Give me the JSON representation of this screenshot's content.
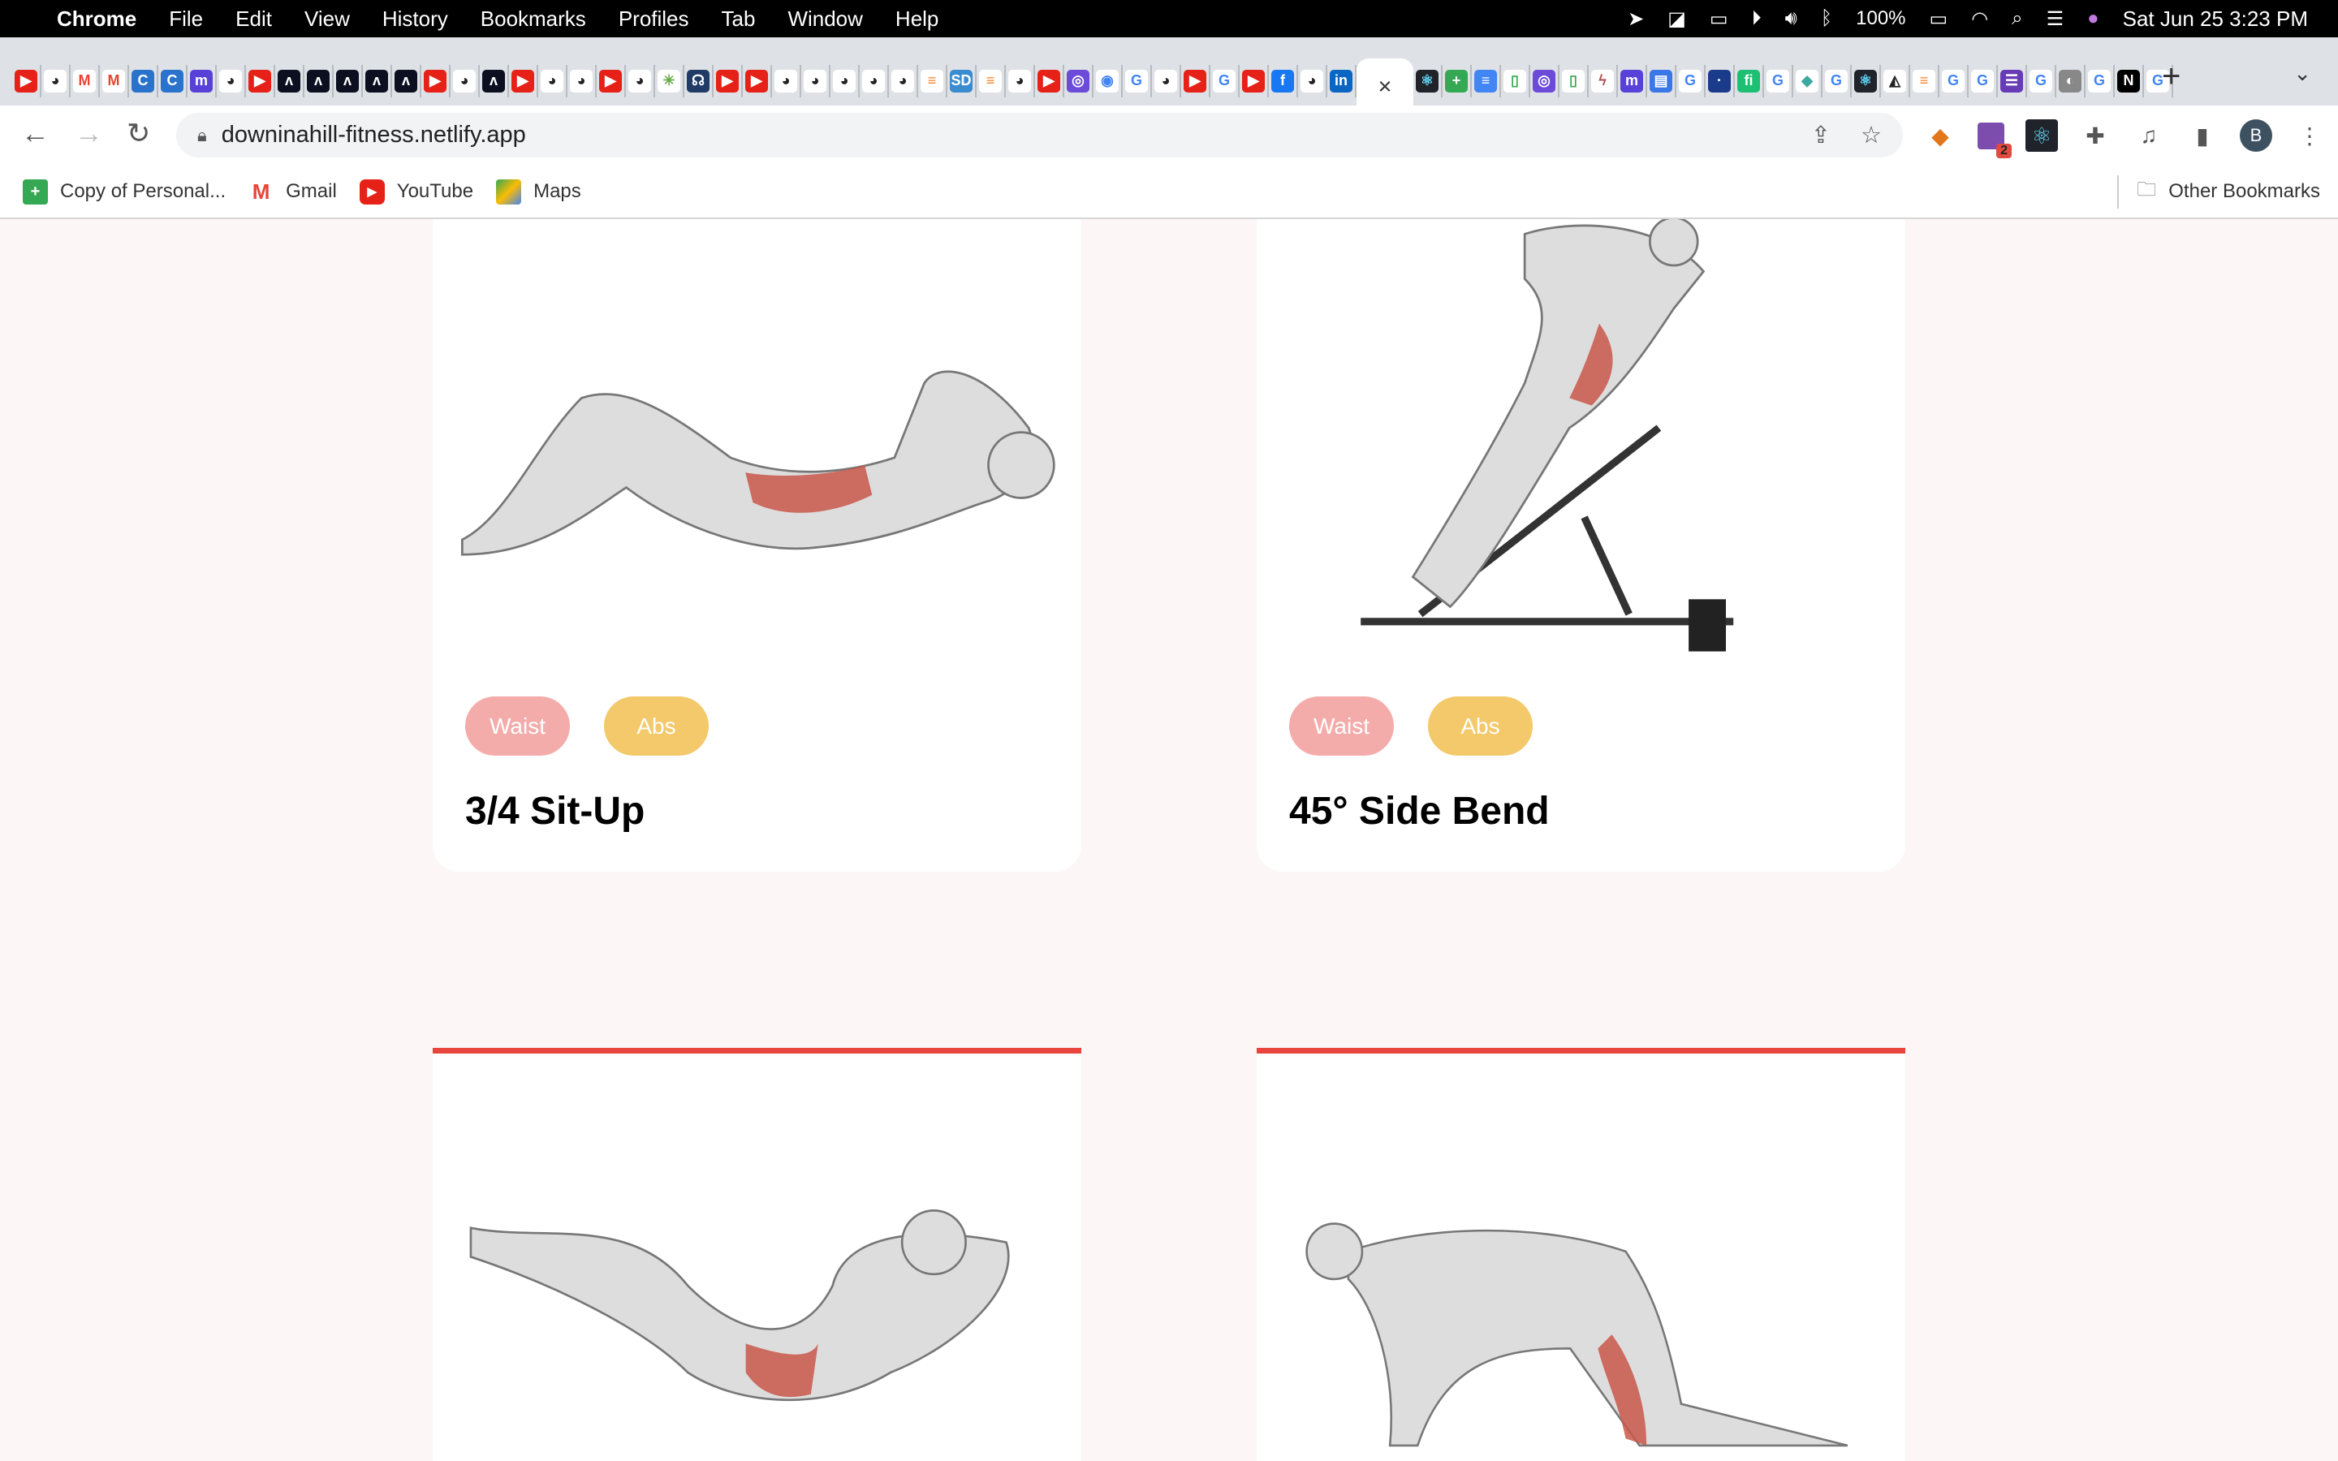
{
  "menubar": {
    "app": "Chrome",
    "items": [
      "File",
      "Edit",
      "View",
      "History",
      "Bookmarks",
      "Profiles",
      "Tab",
      "Window",
      "Help"
    ],
    "battery": "100%",
    "datetime": "Sat Jun 25  3:23 PM"
  },
  "tabs": {
    "icons_before": [
      "youtube",
      "github",
      "gmail",
      "gmail",
      "coursera",
      "coursera",
      "kraken",
      "github",
      "youtube",
      "codewars",
      "codewars",
      "codewars",
      "codewars",
      "codewars",
      "youtube",
      "github",
      "codewars",
      "youtube",
      "github",
      "github",
      "youtube",
      "github",
      "pinwheel",
      "octopus",
      "youtube",
      "youtube",
      "github",
      "github",
      "github",
      "github",
      "github",
      "stackoverflow",
      "sd",
      "stackoverflow",
      "github",
      "youtube",
      "purple",
      "chrome",
      "google",
      "github",
      "youtube",
      "google",
      "youtube",
      "facebook",
      "github",
      "linkedin"
    ],
    "icons_after": [
      "react",
      "sheets",
      "docs",
      "green",
      "purple",
      "green",
      "bird",
      "kraken",
      "blue",
      "google",
      "navy",
      "fiverr",
      "google",
      "teal",
      "google",
      "react",
      "sonar",
      "stackoverflow",
      "google",
      "google",
      "forms",
      "google",
      "gray",
      "google",
      "notion",
      "google"
    ],
    "close": "×",
    "new_tab": "+",
    "tab_list": "⌄"
  },
  "toolbar": {
    "url": "downinahill-fitness.netlify.app",
    "extension_badge": "2",
    "avatar": "B"
  },
  "bookmarks": {
    "items": [
      {
        "label": "Copy of Personal...",
        "icon": "sheets"
      },
      {
        "label": "Gmail",
        "icon": "gmail"
      },
      {
        "label": "YouTube",
        "icon": "youtube"
      },
      {
        "label": "Maps",
        "icon": "maps"
      }
    ],
    "other": "Other Bookmarks"
  },
  "exercises": [
    {
      "name": "3/4 Sit-Up",
      "tags": [
        "Waist",
        "Abs"
      ]
    },
    {
      "name": "45° Side Bend",
      "tags": [
        "Waist",
        "Abs"
      ]
    },
    {
      "name": "",
      "tags": []
    },
    {
      "name": "",
      "tags": []
    }
  ],
  "colors": {
    "waist": "#f4acab",
    "abs": "#f3c96b",
    "accent": "#e8453c",
    "background": "#fdf6f6"
  }
}
